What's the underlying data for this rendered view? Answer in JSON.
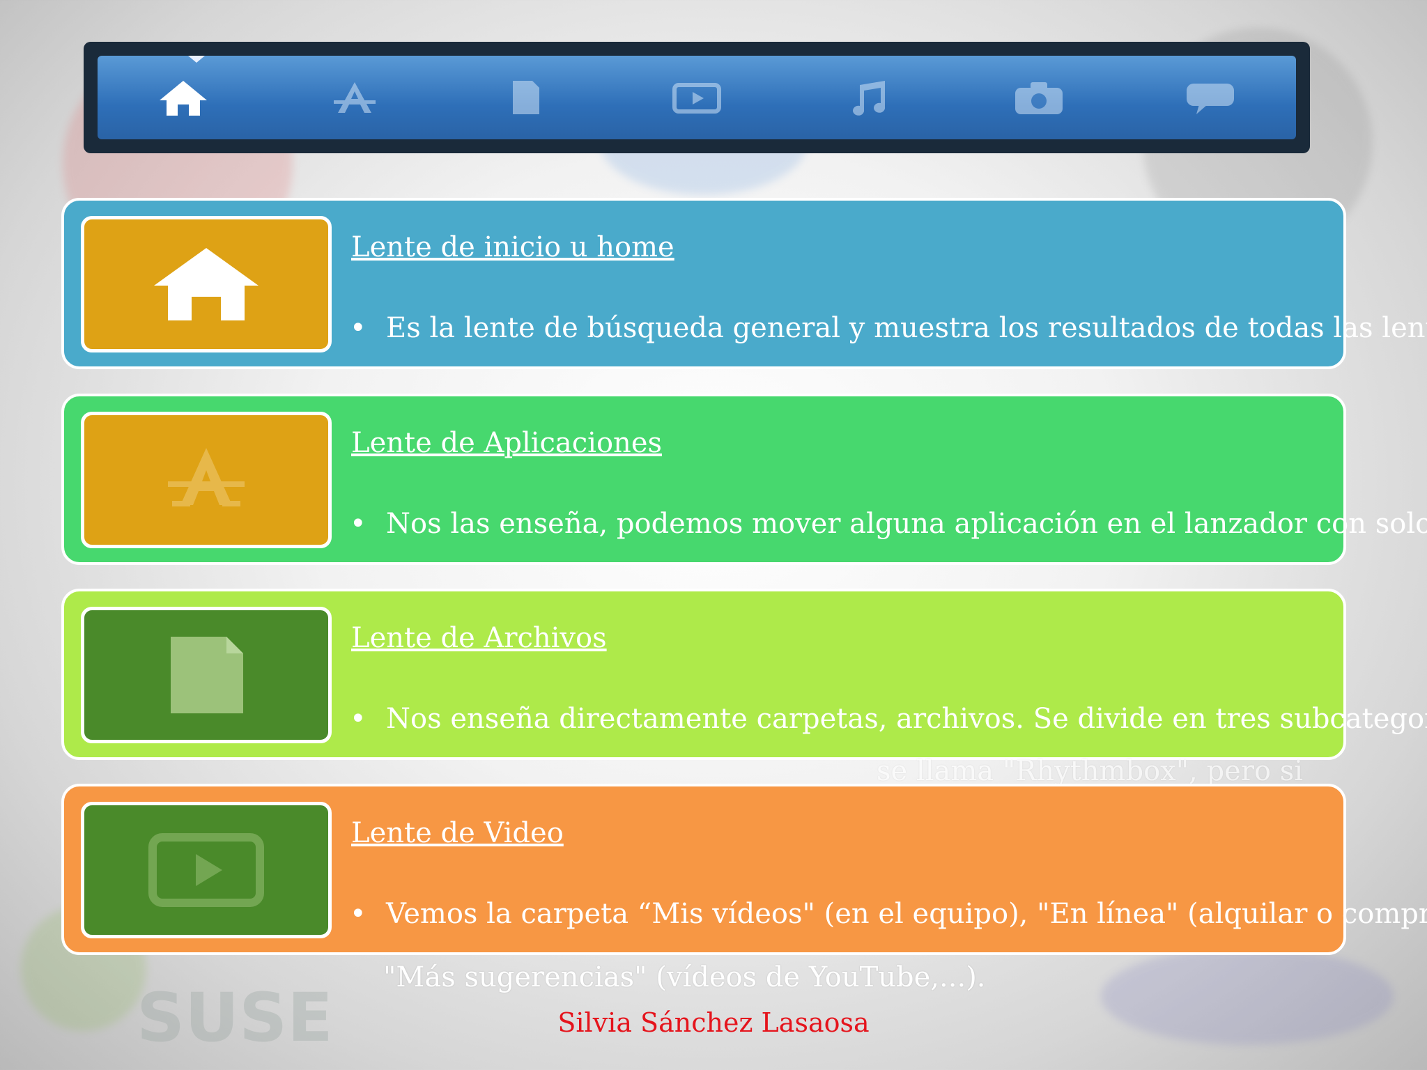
{
  "cards": [
    {
      "title": "Lente de inicio u home",
      "bullet_marker": "•",
      "text": "Es la lente de búsqueda general y muestra los resultados de todas las lentes",
      "icon": "home-icon"
    },
    {
      "title": "Lente de Aplicaciones",
      "bullet_marker": "•",
      "text": "Nos las enseña, podemos mover alguna aplicación en el lanzador con solo",
      "icon": "applications-icon"
    },
    {
      "title": "Lente de Archivos",
      "bullet_marker": "•",
      "text": "Nos enseña directamente carpetas, archivos. Se divide en tres subcategorías:",
      "icon": "file-icon"
    },
    {
      "title": "Lente de Video",
      "bullet_marker": "•",
      "text": "Vemos la carpeta “Mis vídeos\" (en el equipo), \"En línea\" (alquilar o comprar) y",
      "icon": "video-icon"
    }
  ],
  "overflow": {
    "video_continuation": "\"Más sugerencias\" (vídeos de YouTube,...).",
    "archivos_peek": "se llama \"Rhythmbox\", pero si"
  },
  "background": {
    "logo_text": "SUSE"
  },
  "author": "Silvia Sánchez Lasaosa",
  "colors": {
    "card_home": "#4aaacb",
    "card_apps": "#47d86e",
    "card_files": "#aeea4a",
    "card_video": "#f79744",
    "author": "#e5141c"
  }
}
